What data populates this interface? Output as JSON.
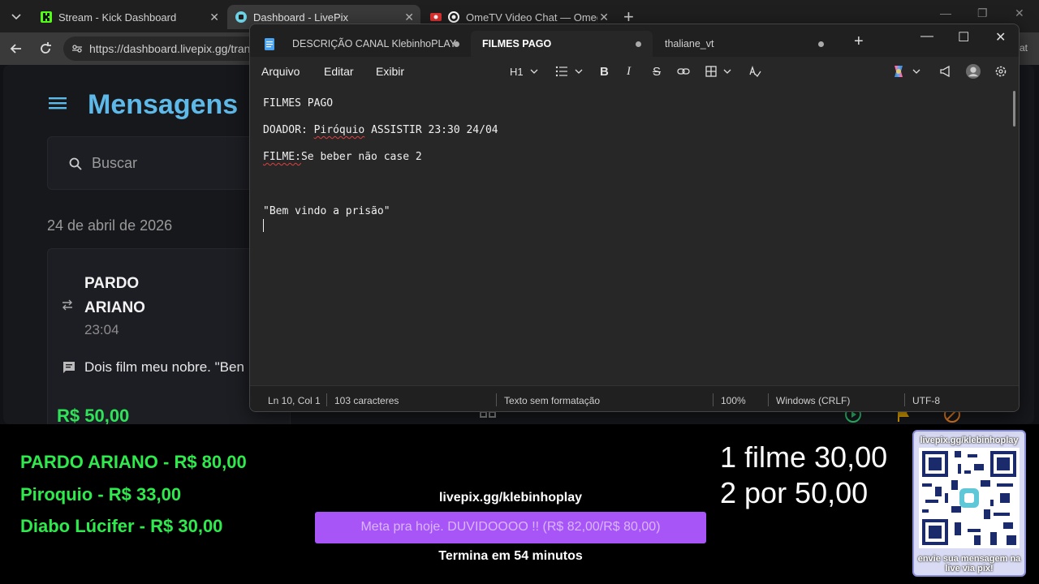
{
  "browser": {
    "tabs": [
      {
        "label": "Stream - Kick Dashboard"
      },
      {
        "label": "Dashboard - LivePix"
      },
      {
        "label": "OmeTV Video Chat — Omegle"
      }
    ],
    "url": "https://dashboard.livepix.gg/tran",
    "right_edge_fragment": "at"
  },
  "dashboard": {
    "title": "Mensagens",
    "search_placeholder": "Buscar",
    "date": "24 de abril de 2026",
    "message": {
      "donor": "PARDO ARIANO",
      "time": "23:04",
      "text": "Dois film meu nobre. \"Ben",
      "amount": "R$ 50,00"
    }
  },
  "notepad": {
    "tabs": [
      {
        "label": "DESCRIÇÃO CANAL KlebinhoPLAY"
      },
      {
        "label": "FILMES PAGO"
      },
      {
        "label": "thaliane_vt"
      }
    ],
    "menu": [
      "Arquivo",
      "Editar",
      "Exibir"
    ],
    "heading_button": "H1",
    "lines": {
      "l1": "FILMES PAGO",
      "l2a": "DOADOR: ",
      "l2b": "Piróquio",
      "l2c": " ASSISTIR 23:30 24/04",
      "l3a": "FILME:",
      "l3b": "Se beber não case 2",
      "l4": "\"Bem vindo a prisão\""
    },
    "status": {
      "position": "Ln 10, Col 1",
      "chars": "103 caracteres",
      "format": "Texto sem formatação",
      "zoom": "100%",
      "line_ending": "Windows (CRLF)",
      "encoding": "UTF-8"
    }
  },
  "overlay": {
    "donations": [
      "PARDO ARIANO - R$ 80,00",
      "Piroquio - R$ 33,00",
      "Diabo Lúcifer - R$ 30,00"
    ],
    "goal_url": "livepix.gg/klebinhoplay",
    "goal_text": "Meta pra hoje. DUVIDOOOO !! (R$ 82,00/R$ 80,00)",
    "goal_ends": "Termina em 54 minutos",
    "prices": [
      "1 filme 30,00",
      "2 por 50,00"
    ],
    "qr_top": "livepix.gg/klebinhoplay",
    "qr_bottom": "envie sua mensagem na live via pix!"
  },
  "colors": {
    "accent_title": "#5fb9e8",
    "donation_green": "#2eea4d",
    "goal_purple": "#a855f7"
  }
}
